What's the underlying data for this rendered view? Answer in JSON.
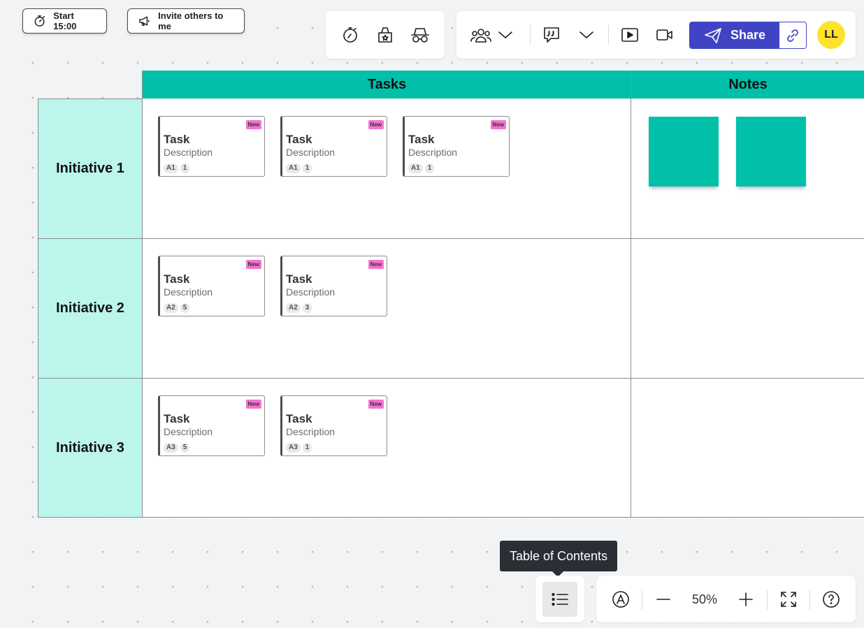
{
  "top_left": {
    "timer_label": "Start 15:00",
    "invite_label": "Invite others to me"
  },
  "toolbar": {
    "share_label": "Share",
    "avatar_initials": "LL",
    "share_color": "#4043c4",
    "avatar_color": "#fde22e"
  },
  "board": {
    "columns": [
      "Tasks",
      "Notes"
    ],
    "rows": [
      "Initiative 1",
      "Initiative 2",
      "Initiative 3"
    ],
    "header_color": "#00c0a9",
    "row_label_color": "#bbf5ec",
    "sticky_color": "#00c0a9",
    "cards": [
      {
        "title": "Task",
        "description": "Description",
        "badge": "New",
        "tag": "A1",
        "count": "1"
      },
      {
        "title": "Task",
        "description": "Description",
        "badge": "New",
        "tag": "A1",
        "count": "1"
      },
      {
        "title": "Task",
        "description": "Description",
        "badge": "New",
        "tag": "A1",
        "count": "1"
      },
      {
        "title": "Task",
        "description": "Description",
        "badge": "New",
        "tag": "A2",
        "count": "5"
      },
      {
        "title": "Task",
        "description": "Description",
        "badge": "New",
        "tag": "A2",
        "count": "3"
      },
      {
        "title": "Task",
        "description": "Description",
        "badge": "New",
        "tag": "A3",
        "count": "5"
      },
      {
        "title": "Task",
        "description": "Description",
        "badge": "New",
        "tag": "A3",
        "count": "1"
      }
    ]
  },
  "bottom": {
    "tooltip": "Table of Contents",
    "zoom": "50%"
  }
}
